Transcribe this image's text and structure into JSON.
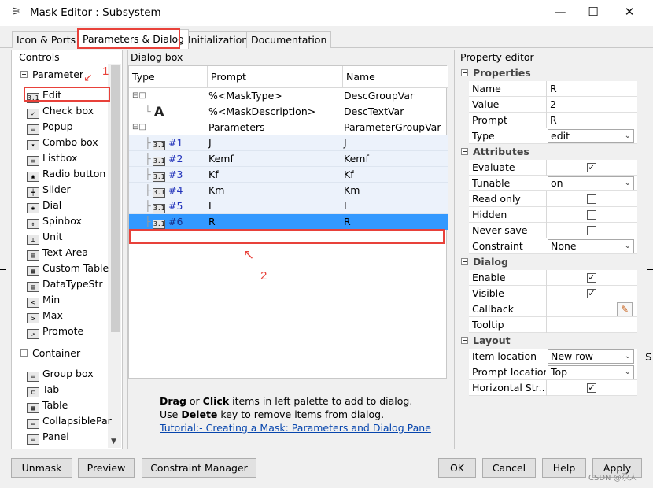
{
  "window": {
    "title": "Mask Editor : Subsystem",
    "minimize": "—",
    "maximize": "☐",
    "close": "✕"
  },
  "tabs": [
    {
      "label": "Icon & Ports"
    },
    {
      "label": "Parameters & Dialog"
    },
    {
      "label": "Initialization"
    },
    {
      "label": "Documentation"
    }
  ],
  "controls": {
    "title": "Controls",
    "group_parameter": "Parameter",
    "group_container": "Container",
    "parameter_items": [
      {
        "label": "Edit",
        "icon": "edit-icon"
      },
      {
        "label": "Check box",
        "icon": "checkbox-icon"
      },
      {
        "label": "Popup",
        "icon": "popup-icon"
      },
      {
        "label": "Combo box",
        "icon": "combobox-icon"
      },
      {
        "label": "Listbox",
        "icon": "listbox-icon"
      },
      {
        "label": "Radio button",
        "icon": "radio-button-icon"
      },
      {
        "label": "Slider",
        "icon": "slider-icon"
      },
      {
        "label": "Dial",
        "icon": "dial-icon"
      },
      {
        "label": "Spinbox",
        "icon": "spinbox-icon"
      },
      {
        "label": "Unit",
        "icon": "unit-icon"
      },
      {
        "label": "Text Area",
        "icon": "text-area-icon"
      },
      {
        "label": "Custom Table",
        "icon": "custom-table-icon"
      },
      {
        "label": "DataTypeStr",
        "icon": "datatype-icon"
      },
      {
        "label": "Min",
        "icon": "min-icon"
      },
      {
        "label": "Max",
        "icon": "max-icon"
      },
      {
        "label": "Promote",
        "icon": "promote-icon"
      }
    ],
    "container_items": [
      {
        "label": "Group box",
        "icon": "group-box-icon"
      },
      {
        "label": "Tab",
        "icon": "tab-icon"
      },
      {
        "label": "Table",
        "icon": "table-icon"
      },
      {
        "label": "CollapsiblePar",
        "icon": "collapsible-panel-icon"
      },
      {
        "label": "Panel",
        "icon": "panel-icon"
      }
    ]
  },
  "dialog_box": {
    "title": "Dialog box",
    "columns": {
      "type": "Type",
      "prompt": "Prompt",
      "name": "Name"
    },
    "rows": [
      {
        "type": "",
        "prompt": "%<MaskType>",
        "name": "DescGroupVar"
      },
      {
        "type": "A",
        "prompt": "%<MaskDescription>",
        "name": "DescTextVar"
      },
      {
        "type": "",
        "prompt": "Parameters",
        "name": "ParameterGroupVar"
      },
      {
        "type": "#1",
        "prompt": "J",
        "name": "J"
      },
      {
        "type": "#2",
        "prompt": "Kemf",
        "name": "Kemf"
      },
      {
        "type": "#3",
        "prompt": "Kf",
        "name": "Kf"
      },
      {
        "type": "#4",
        "prompt": "Km",
        "name": "Km"
      },
      {
        "type": "#5",
        "prompt": "L",
        "name": "L"
      },
      {
        "type": "#6",
        "prompt": "R",
        "name": "R"
      }
    ],
    "help_drag": "Drag",
    "help_or": " or ",
    "help_click": "Click",
    "help_rest1": " items in left palette to add to dialog.",
    "help_use": "Use ",
    "help_delete": "Delete",
    "help_rest2": " key to remove items from dialog.",
    "help_link": "Tutorial:- Creating a Mask: Parameters and Dialog Pane"
  },
  "annotations": {
    "mark1": "1",
    "mark2": "2"
  },
  "property_editor": {
    "title": "Property editor",
    "sections": {
      "properties": "Properties",
      "attributes": "Attributes",
      "dialog": "Dialog",
      "layout": "Layout"
    },
    "properties": {
      "name_label": "Name",
      "name_value": "R",
      "value_label": "Value",
      "value_value": "2",
      "prompt_label": "Prompt",
      "prompt_value": "R",
      "type_label": "Type",
      "type_value": "edit"
    },
    "attributes": {
      "evaluate_label": "Evaluate",
      "tunable_label": "Tunable",
      "tunable_value": "on",
      "readonly_label": "Read only",
      "hidden_label": "Hidden",
      "neversave_label": "Never save",
      "constraint_label": "Constraint",
      "constraint_value": "None"
    },
    "dialog": {
      "enable_label": "Enable",
      "visible_label": "Visible",
      "callback_label": "Callback",
      "tooltip_label": "Tooltip"
    },
    "layout": {
      "item_location_label": "Item location",
      "item_location_value": "New row",
      "prompt_location_label": "Prompt location",
      "prompt_location_value": "Top",
      "horizontal_stretch_label": "Horizontal Str..."
    },
    "check": "✓"
  },
  "buttons": {
    "unmask": "Unmask",
    "preview": "Preview",
    "constraint_manager": "Constraint Manager",
    "ok": "OK",
    "cancel": "Cancel",
    "help": "Help",
    "apply": "Apply"
  },
  "watermark": "CSDN @尕人",
  "background_fragment": "sp",
  "colors": {
    "selection": "#3399ff",
    "annotation_red": "#e8413a",
    "param_row": "#ecf2fb",
    "link": "#0645ad"
  }
}
